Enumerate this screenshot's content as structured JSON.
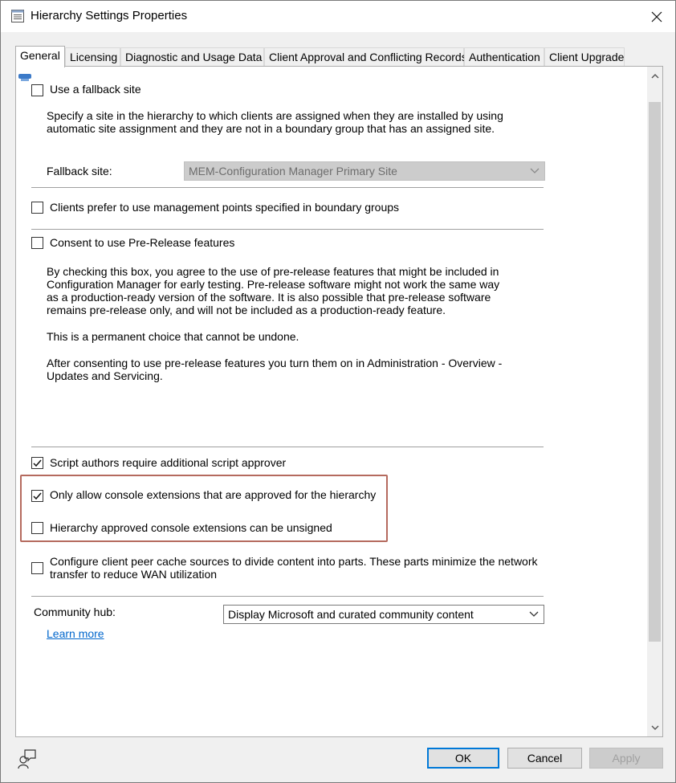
{
  "window": {
    "title": "Hierarchy Settings Properties",
    "title_icon": "properties-window-icon",
    "close_icon": "close-icon"
  },
  "tabs": [
    {
      "label": "General",
      "active": true
    },
    {
      "label": "Licensing"
    },
    {
      "label": "Diagnostic and Usage Data"
    },
    {
      "label": "Client Approval and Conflicting Records"
    },
    {
      "label": "Authentication"
    },
    {
      "label": "Client Upgrade"
    }
  ],
  "general": {
    "fallback_site": {
      "checkbox_label": "Use a fallback site",
      "checked": false,
      "description": "Specify a site in the hierarchy to which clients are assigned when they are installed by using automatic site assignment and they are not in a boundary group that has an assigned site.",
      "field_label": "Fallback site:",
      "field_value": "MEM-Configuration Manager Primary Site"
    },
    "prefer_mp": {
      "checkbox_label": "Clients prefer to use management points specified in boundary groups",
      "checked": false
    },
    "prerelease": {
      "checkbox_label": "Consent to use Pre-Release features",
      "checked": false,
      "description_1": "By checking this box, you agree to the use of pre-release features that might be included in Configuration Manager for early testing. Pre-release software might not work the same way as a production-ready version of the software. It is also possible that pre-release software remains pre-release only, and will not be included as a production-ready feature.",
      "description_2": "This is a permanent choice that cannot be undone.",
      "description_3": "After consenting to use pre-release features you turn them on in Administration - Overview - Updates and Servicing."
    },
    "script_approver": {
      "checkbox_label": "Script authors require additional script approver",
      "checked": true
    },
    "console_ext_approved": {
      "checkbox_label": "Only allow console extensions that are approved for the hierarchy",
      "checked": true
    },
    "console_ext_unsigned": {
      "checkbox_label": "Hierarchy approved console extensions can be unsigned",
      "checked": false
    },
    "peer_cache": {
      "checkbox_label": "Configure client peer cache sources to divide content into parts. These parts minimize the network transfer to reduce WAN utilization",
      "checked": false
    },
    "community_hub": {
      "label": "Community hub:",
      "value": "Display Microsoft and curated community content",
      "learn_more": "Learn more"
    }
  },
  "buttons": {
    "ok": "OK",
    "cancel": "Cancel",
    "apply": "Apply"
  },
  "colors": {
    "highlight_border": "#b56a5e",
    "link": "#0066cc",
    "default_button_border": "#0078d7"
  }
}
